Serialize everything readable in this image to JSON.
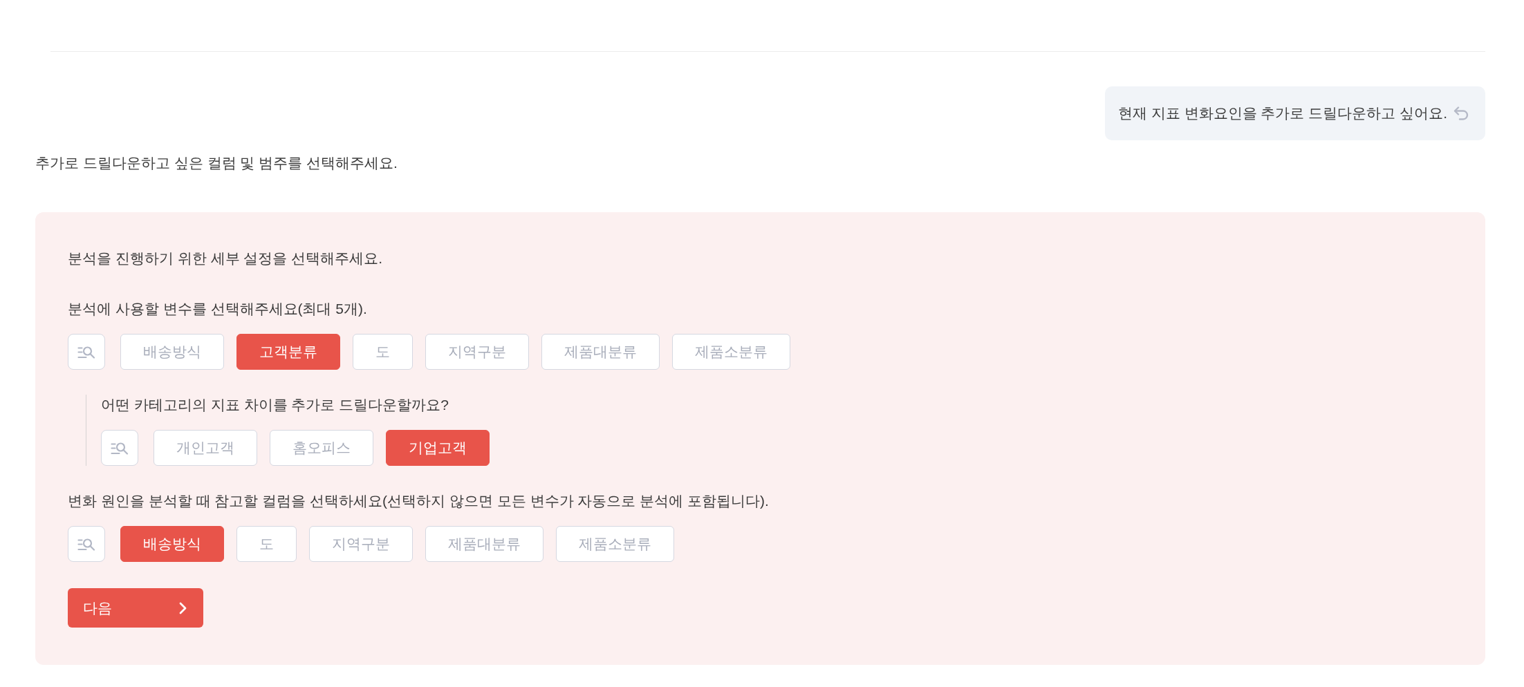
{
  "user_message": {
    "text": "현재 지표 변화요인을 추가로 드릴다운하고 싶어요."
  },
  "assistant_message": {
    "text": "추가로 드릴다운하고 싶은 컬럼 및 범주를 선택해주세요."
  },
  "settings_panel": {
    "intro": "분석을 진행하기 위한 세부 설정을 선택해주세요.",
    "sections": [
      {
        "kind": "main",
        "prompt": "분석에 사용할 변수를 선택해주세요(최대 5개).",
        "options": [
          {
            "label": "배송방식",
            "selected": false
          },
          {
            "label": "고객분류",
            "selected": true
          },
          {
            "label": "도",
            "selected": false
          },
          {
            "label": "지역구분",
            "selected": false
          },
          {
            "label": "제품대분류",
            "selected": false
          },
          {
            "label": "제품소분류",
            "selected": false
          }
        ]
      },
      {
        "kind": "nested",
        "prompt": "어떤 카테고리의 지표 차이를 추가로 드릴다운할까요?",
        "options": [
          {
            "label": "개인고객",
            "selected": false
          },
          {
            "label": "홈오피스",
            "selected": false
          },
          {
            "label": "기업고객",
            "selected": true
          }
        ]
      },
      {
        "kind": "main",
        "prompt": "변화 원인을 분석할 때 참고할 컬럼을 선택하세요(선택하지 않으면 모든 변수가 자동으로 분석에 포함됩니다).",
        "options": [
          {
            "label": "배송방식",
            "selected": true
          },
          {
            "label": "도",
            "selected": false
          },
          {
            "label": "지역구분",
            "selected": false
          },
          {
            "label": "제품대분류",
            "selected": false
          },
          {
            "label": "제품소분류",
            "selected": false
          }
        ]
      }
    ],
    "next_button": {
      "label": "다음"
    }
  }
}
